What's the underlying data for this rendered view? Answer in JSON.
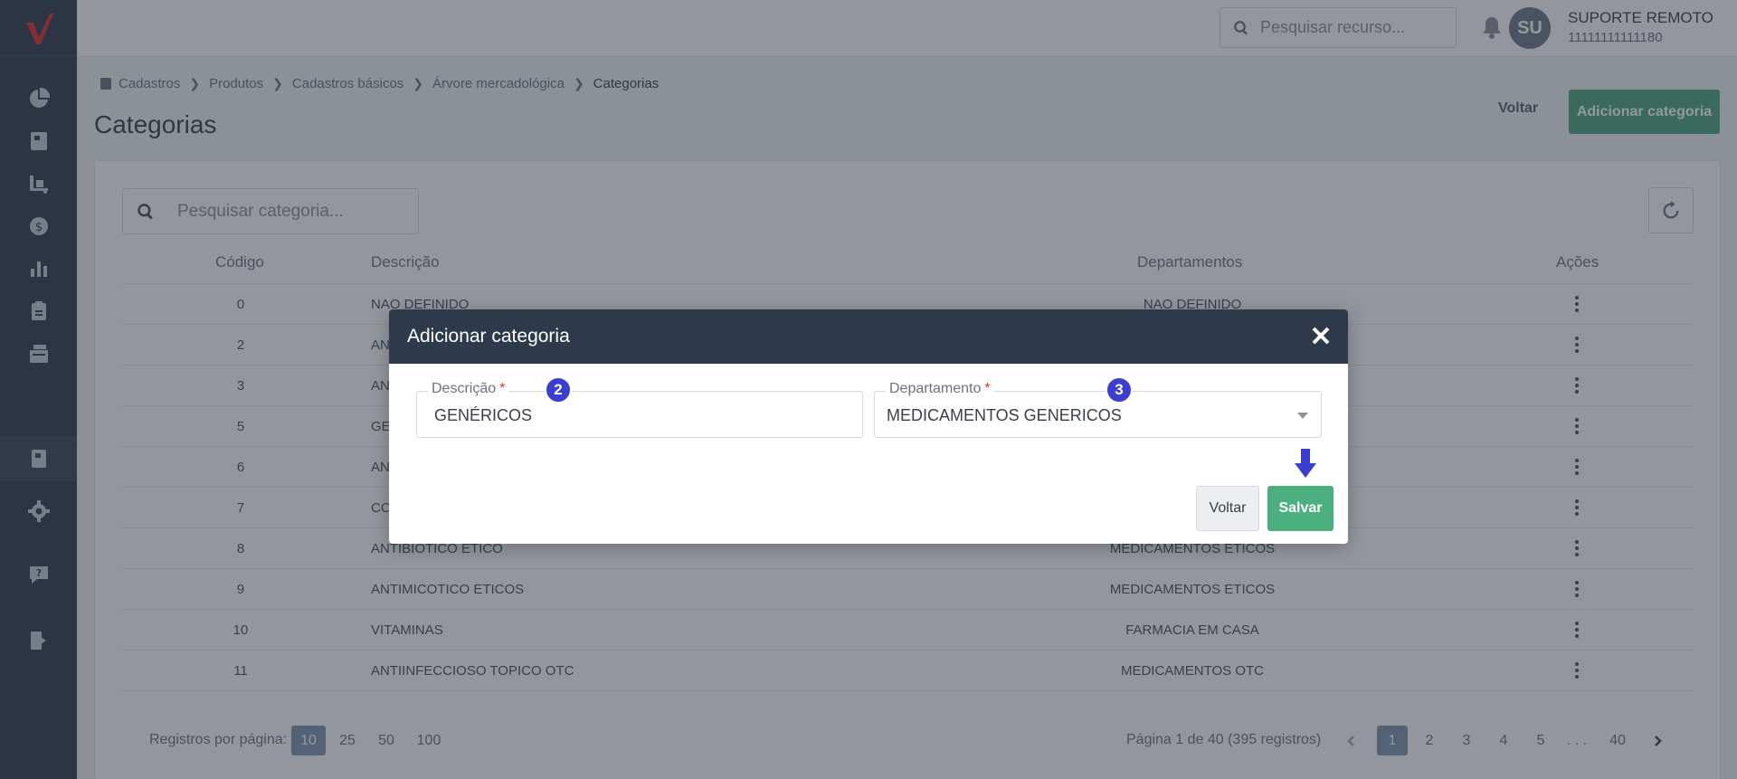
{
  "topbar": {
    "search_placeholder": "Pesquisar recurso...",
    "user_initials": "SU",
    "user_name": "SUPORTE REMOTO",
    "user_id": "11111111111180"
  },
  "breadcrumb": [
    "Cadastros",
    "Produtos",
    "Cadastros básicos",
    "Árvore mercadológica",
    "Categorias"
  ],
  "page": {
    "title": "Categorias",
    "back_label": "Voltar",
    "add_label": "Adicionar categoria"
  },
  "table": {
    "search_placeholder": "Pesquisar categoria...",
    "headers": {
      "code": "Código",
      "description": "Descrição",
      "departments": "Departamentos",
      "actions": "Ações"
    },
    "rows": [
      {
        "code": "0",
        "description": "NAO DEFINIDO",
        "department": "NAO DEFINIDO"
      },
      {
        "code": "2",
        "description": "AN",
        "department": ""
      },
      {
        "code": "3",
        "description": "AN",
        "department": ""
      },
      {
        "code": "5",
        "description": "GE",
        "department": ""
      },
      {
        "code": "6",
        "description": "AN",
        "department": ""
      },
      {
        "code": "7",
        "description": "CO",
        "department": ""
      },
      {
        "code": "8",
        "description": "ANTIBIOTICO ETICO",
        "department": "MEDICAMENTOS ETICOS"
      },
      {
        "code": "9",
        "description": "ANTIMICOTICO ETICOS",
        "department": "MEDICAMENTOS ETICOS"
      },
      {
        "code": "10",
        "description": "VITAMINAS",
        "department": "FARMACIA EM CASA"
      },
      {
        "code": "11",
        "description": "ANTIINFECCIOSO TOPICO OTC",
        "department": "MEDICAMENTOS OTC"
      }
    ]
  },
  "pagination": {
    "per_page_label": "Registros por página:",
    "per_page_options": [
      "10",
      "25",
      "50",
      "100"
    ],
    "info": "Página 1 de 40 (395 registros)",
    "pages": [
      "1",
      "2",
      "3",
      "4",
      "5",
      ". . .",
      "40"
    ]
  },
  "modal": {
    "title": "Adicionar categoria",
    "description_label": "Descrição",
    "description_value": "GENÉRICOS",
    "department_label": "Departamento",
    "department_value": "MEDICAMENTOS GENERICOS",
    "required_mark": "*",
    "badge_1": "2",
    "badge_2": "3",
    "back_label": "Voltar",
    "save_label": "Salvar"
  },
  "colors": {
    "sidebar": "#2e3a4b",
    "primary_green": "#4caf80",
    "annotation_blue": "#3b3fd1",
    "required_red": "#d9342b"
  },
  "icons": [
    "logo-icon",
    "dashboard-icon",
    "book-icon",
    "logistics-icon",
    "money-icon",
    "chart-icon",
    "clipboard-icon",
    "documents-icon",
    "catalog-icon",
    "gear-icon",
    "help-icon",
    "logout-icon",
    "search-icon",
    "bell-icon",
    "chevron-right-icon",
    "refresh-icon",
    "kebab-icon",
    "close-icon",
    "arrow-down-icon"
  ]
}
